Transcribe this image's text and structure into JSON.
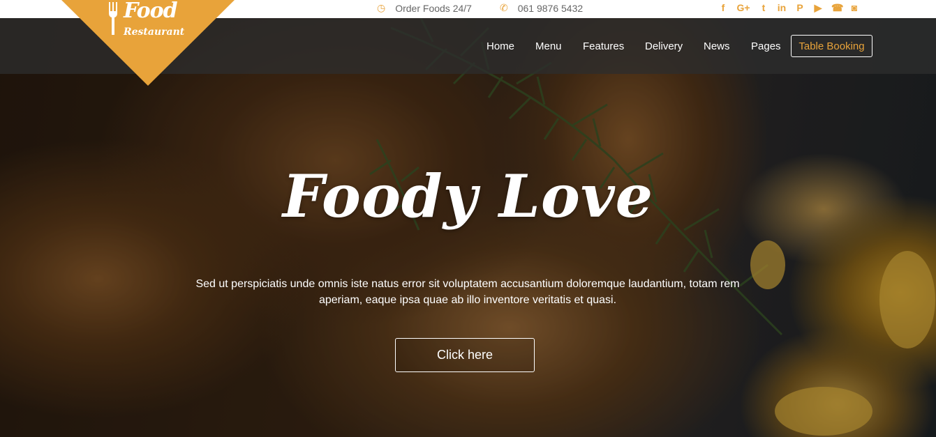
{
  "topbar": {
    "hours_text": "Order Foods 24/7",
    "phone_text": "061 9876 5432",
    "socials": [
      {
        "name": "facebook-icon",
        "glyph": "f"
      },
      {
        "name": "google-plus-icon",
        "glyph": "G+"
      },
      {
        "name": "twitter-icon",
        "glyph": "t"
      },
      {
        "name": "linkedin-icon",
        "glyph": "in"
      },
      {
        "name": "pinterest-icon",
        "glyph": "P"
      },
      {
        "name": "youtube-icon",
        "glyph": "▶"
      },
      {
        "name": "phone-icon",
        "glyph": "☎"
      },
      {
        "name": "camera-icon",
        "glyph": "◙"
      }
    ]
  },
  "logo": {
    "line1": "Food",
    "line2": "Restaurant"
  },
  "nav": {
    "items": [
      "Home",
      "Menu",
      "Features",
      "Delivery",
      "News",
      "Pages"
    ],
    "booking_label": "Table Booking"
  },
  "hero": {
    "title": "Foody Love",
    "text": "Sed ut perspiciatis unde omnis iste natus error sit voluptatem accusantium doloremque laudantium, totam rem aperiam, eaque ipsa quae ab illo inventore veritatis et quasi.",
    "cta_label": "Click here"
  },
  "colors": {
    "accent": "#e8a33a",
    "nav_bg": "#2d2d2d",
    "text_light": "#ffffff"
  }
}
